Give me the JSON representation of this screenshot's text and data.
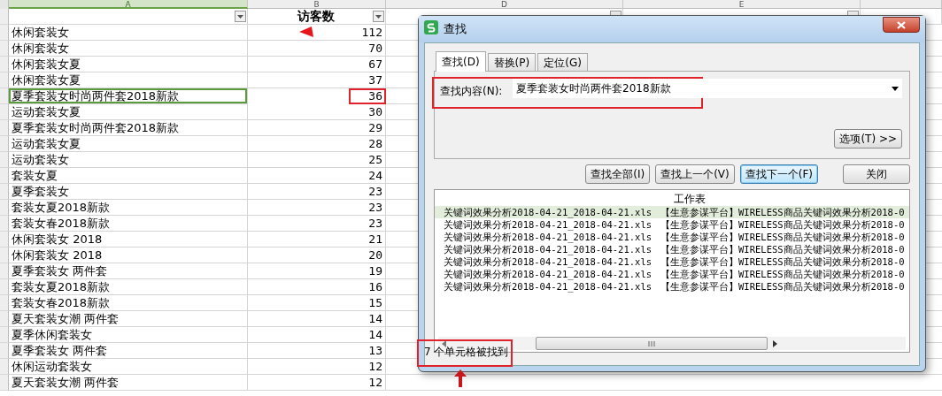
{
  "sheet": {
    "columns": [
      {
        "letter": "A",
        "selected": true
      },
      {
        "letter": "B",
        "selected": false
      },
      {
        "letter": "D",
        "selected": false
      },
      {
        "letter": "E",
        "selected": false
      }
    ],
    "header": {
      "column_2": "访客数",
      "column_2_marked": true
    },
    "rows": [
      {
        "keyword": "休闲套装女",
        "visitors": "112",
        "active": false,
        "highlighted": false
      },
      {
        "keyword": "休闲套装女",
        "visitors": "70",
        "active": false,
        "highlighted": false
      },
      {
        "keyword": "休闲套装女夏",
        "visitors": "67",
        "active": false,
        "highlighted": false
      },
      {
        "keyword": "休闲套装女夏",
        "visitors": "37",
        "active": false,
        "highlighted": false
      },
      {
        "keyword": "夏季套装女时尚两件套2018新款",
        "visitors": "36",
        "active": true,
        "highlighted": true
      },
      {
        "keyword": "运动套装女夏",
        "visitors": "30",
        "active": false,
        "highlighted": false
      },
      {
        "keyword": "夏季套装女时尚两件套2018新款",
        "visitors": "29",
        "active": false,
        "highlighted": false
      },
      {
        "keyword": "运动套装女夏",
        "visitors": "28",
        "active": false,
        "highlighted": false
      },
      {
        "keyword": "运动套装女",
        "visitors": "25",
        "active": false,
        "highlighted": false
      },
      {
        "keyword": "套装女夏",
        "visitors": "24",
        "active": false,
        "highlighted": false
      },
      {
        "keyword": "夏季套装女",
        "visitors": "23",
        "active": false,
        "highlighted": false
      },
      {
        "keyword": "套装女夏2018新款",
        "visitors": "23",
        "active": false,
        "highlighted": false
      },
      {
        "keyword": "套装女春2018新款",
        "visitors": "23",
        "active": false,
        "highlighted": false
      },
      {
        "keyword": "休闲套装女 2018",
        "visitors": "21",
        "active": false,
        "highlighted": false
      },
      {
        "keyword": "休闲套装女 2018",
        "visitors": "20",
        "active": false,
        "highlighted": false
      },
      {
        "keyword": "夏季套装女 两件套",
        "visitors": "19",
        "active": false,
        "highlighted": false
      },
      {
        "keyword": "套装女夏2018新款",
        "visitors": "16",
        "active": false,
        "highlighted": false
      },
      {
        "keyword": "套装女春2018新款",
        "visitors": "15",
        "active": false,
        "highlighted": false
      },
      {
        "keyword": "夏天套装女潮 两件套",
        "visitors": "14",
        "active": false,
        "highlighted": false
      },
      {
        "keyword": "夏季休闲套装女",
        "visitors": "14",
        "active": false,
        "highlighted": false
      },
      {
        "keyword": "夏季套装女 两件套",
        "visitors": "13",
        "active": false,
        "highlighted": false
      },
      {
        "keyword": "休闲运动套装女",
        "visitors": "12",
        "active": false,
        "highlighted": false
      },
      {
        "keyword": "夏天套装女潮 两件套",
        "visitors": "12",
        "active": false,
        "highlighted": false
      }
    ]
  },
  "dialog": {
    "title": "查找",
    "tabs": [
      {
        "label": "查找(D)",
        "selected": true
      },
      {
        "label": "替换(P)",
        "selected": false
      },
      {
        "label": "定位(G)",
        "selected": false
      }
    ],
    "find_label": "查找内容(N):",
    "find_value": "夏季套装女时尚两件套2018新款",
    "find_highlighted": true,
    "options_button": "选项(T) >>",
    "buttons": [
      {
        "label": "查找全部(I)",
        "focused": false
      },
      {
        "label": "查找上一个(V)",
        "focused": false
      },
      {
        "label": "查找下一个(F)",
        "focused": true
      },
      {
        "label": "关闭",
        "focused": false
      }
    ],
    "results": {
      "column_header": "工作表",
      "rows": [
        {
          "workbook": "关键词效果分析2018-04-21_2018-04-21.xls",
          "sheet": "【生意参谋平台】WIRELESS商品关键词效果分析2018-0",
          "selected": true
        },
        {
          "workbook": "关键词效果分析2018-04-21_2018-04-21.xls",
          "sheet": "【生意参谋平台】WIRELESS商品关键词效果分析2018-0",
          "selected": false
        },
        {
          "workbook": "关键词效果分析2018-04-21_2018-04-21.xls",
          "sheet": "【生意参谋平台】WIRELESS商品关键词效果分析2018-0",
          "selected": false
        },
        {
          "workbook": "关键词效果分析2018-04-21_2018-04-21.xls",
          "sheet": "【生意参谋平台】WIRELESS商品关键词效果分析2018-0",
          "selected": false
        },
        {
          "workbook": "关键词效果分析2018-04-21_2018-04-21.xls",
          "sheet": "【生意参谋平台】WIRELESS商品关键词效果分析2018-0",
          "selected": false
        },
        {
          "workbook": "关键词效果分析2018-04-21_2018-04-21.xls",
          "sheet": "【生意参谋平台】WIRELESS商品关键词效果分析2018-0",
          "selected": false
        },
        {
          "workbook": "关键词效果分析2018-04-21_2018-04-21.xls",
          "sheet": "【生意参谋平台】WIRELESS商品关键词效果分析2018-0",
          "selected": false
        }
      ]
    },
    "status": "7 个单元格被找到",
    "status_highlighted": true
  }
}
